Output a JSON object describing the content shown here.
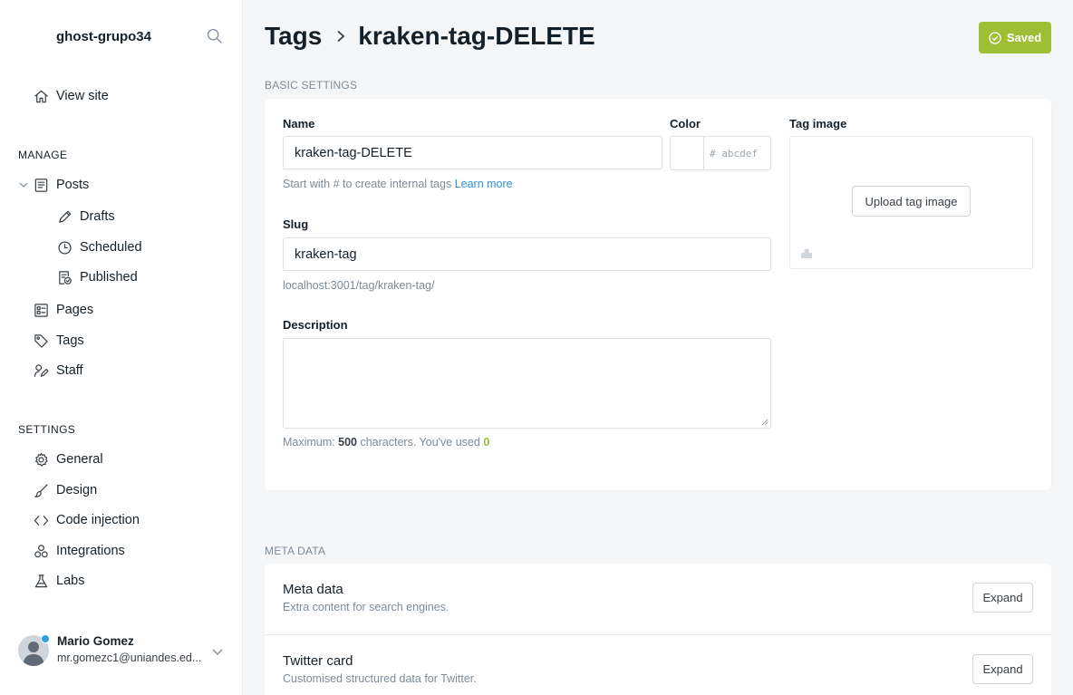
{
  "sidebar": {
    "site_title": "ghost-grupo34",
    "view_site": "View site",
    "manage_heading": "MANAGE",
    "posts": "Posts",
    "drafts": "Drafts",
    "scheduled": "Scheduled",
    "published": "Published",
    "pages": "Pages",
    "tags": "Tags",
    "staff": "Staff",
    "settings_heading": "SETTINGS",
    "general": "General",
    "design": "Design",
    "code_injection": "Code injection",
    "integrations": "Integrations",
    "labs": "Labs",
    "user": {
      "name": "Mario Gomez",
      "email": "mr.gomezc1@uniandes.ed..."
    }
  },
  "header": {
    "breadcrumb_root": "Tags",
    "breadcrumb_current": "kraken-tag-DELETE",
    "saved_label": "Saved"
  },
  "basic": {
    "section_label": "BASIC SETTINGS",
    "name_label": "Name",
    "name_value": "kraken-tag-DELETE",
    "name_hint": "Start with # to create internal tags",
    "learn_more": "Learn more",
    "color_label": "Color",
    "color_placeholder": "# abcdef",
    "image_label": "Tag image",
    "upload_label": "Upload tag image",
    "slug_label": "Slug",
    "slug_value": "kraken-tag",
    "slug_url": "localhost:3001/tag/kraken-tag/",
    "description_label": "Description",
    "desc_hint_pre": "Maximum:",
    "desc_max": "500",
    "desc_hint_mid": "characters. You've used",
    "desc_used": "0"
  },
  "meta": {
    "section_label": "META DATA",
    "rows": [
      {
        "title": "Meta data",
        "subtitle": "Extra content for search engines.",
        "button": "Expand"
      },
      {
        "title": "Twitter card",
        "subtitle": "Customised structured data for Twitter.",
        "button": "Expand"
      }
    ]
  },
  "colors": {
    "accent_green": "#9ebf35",
    "link_blue": "#2f8fd6"
  }
}
